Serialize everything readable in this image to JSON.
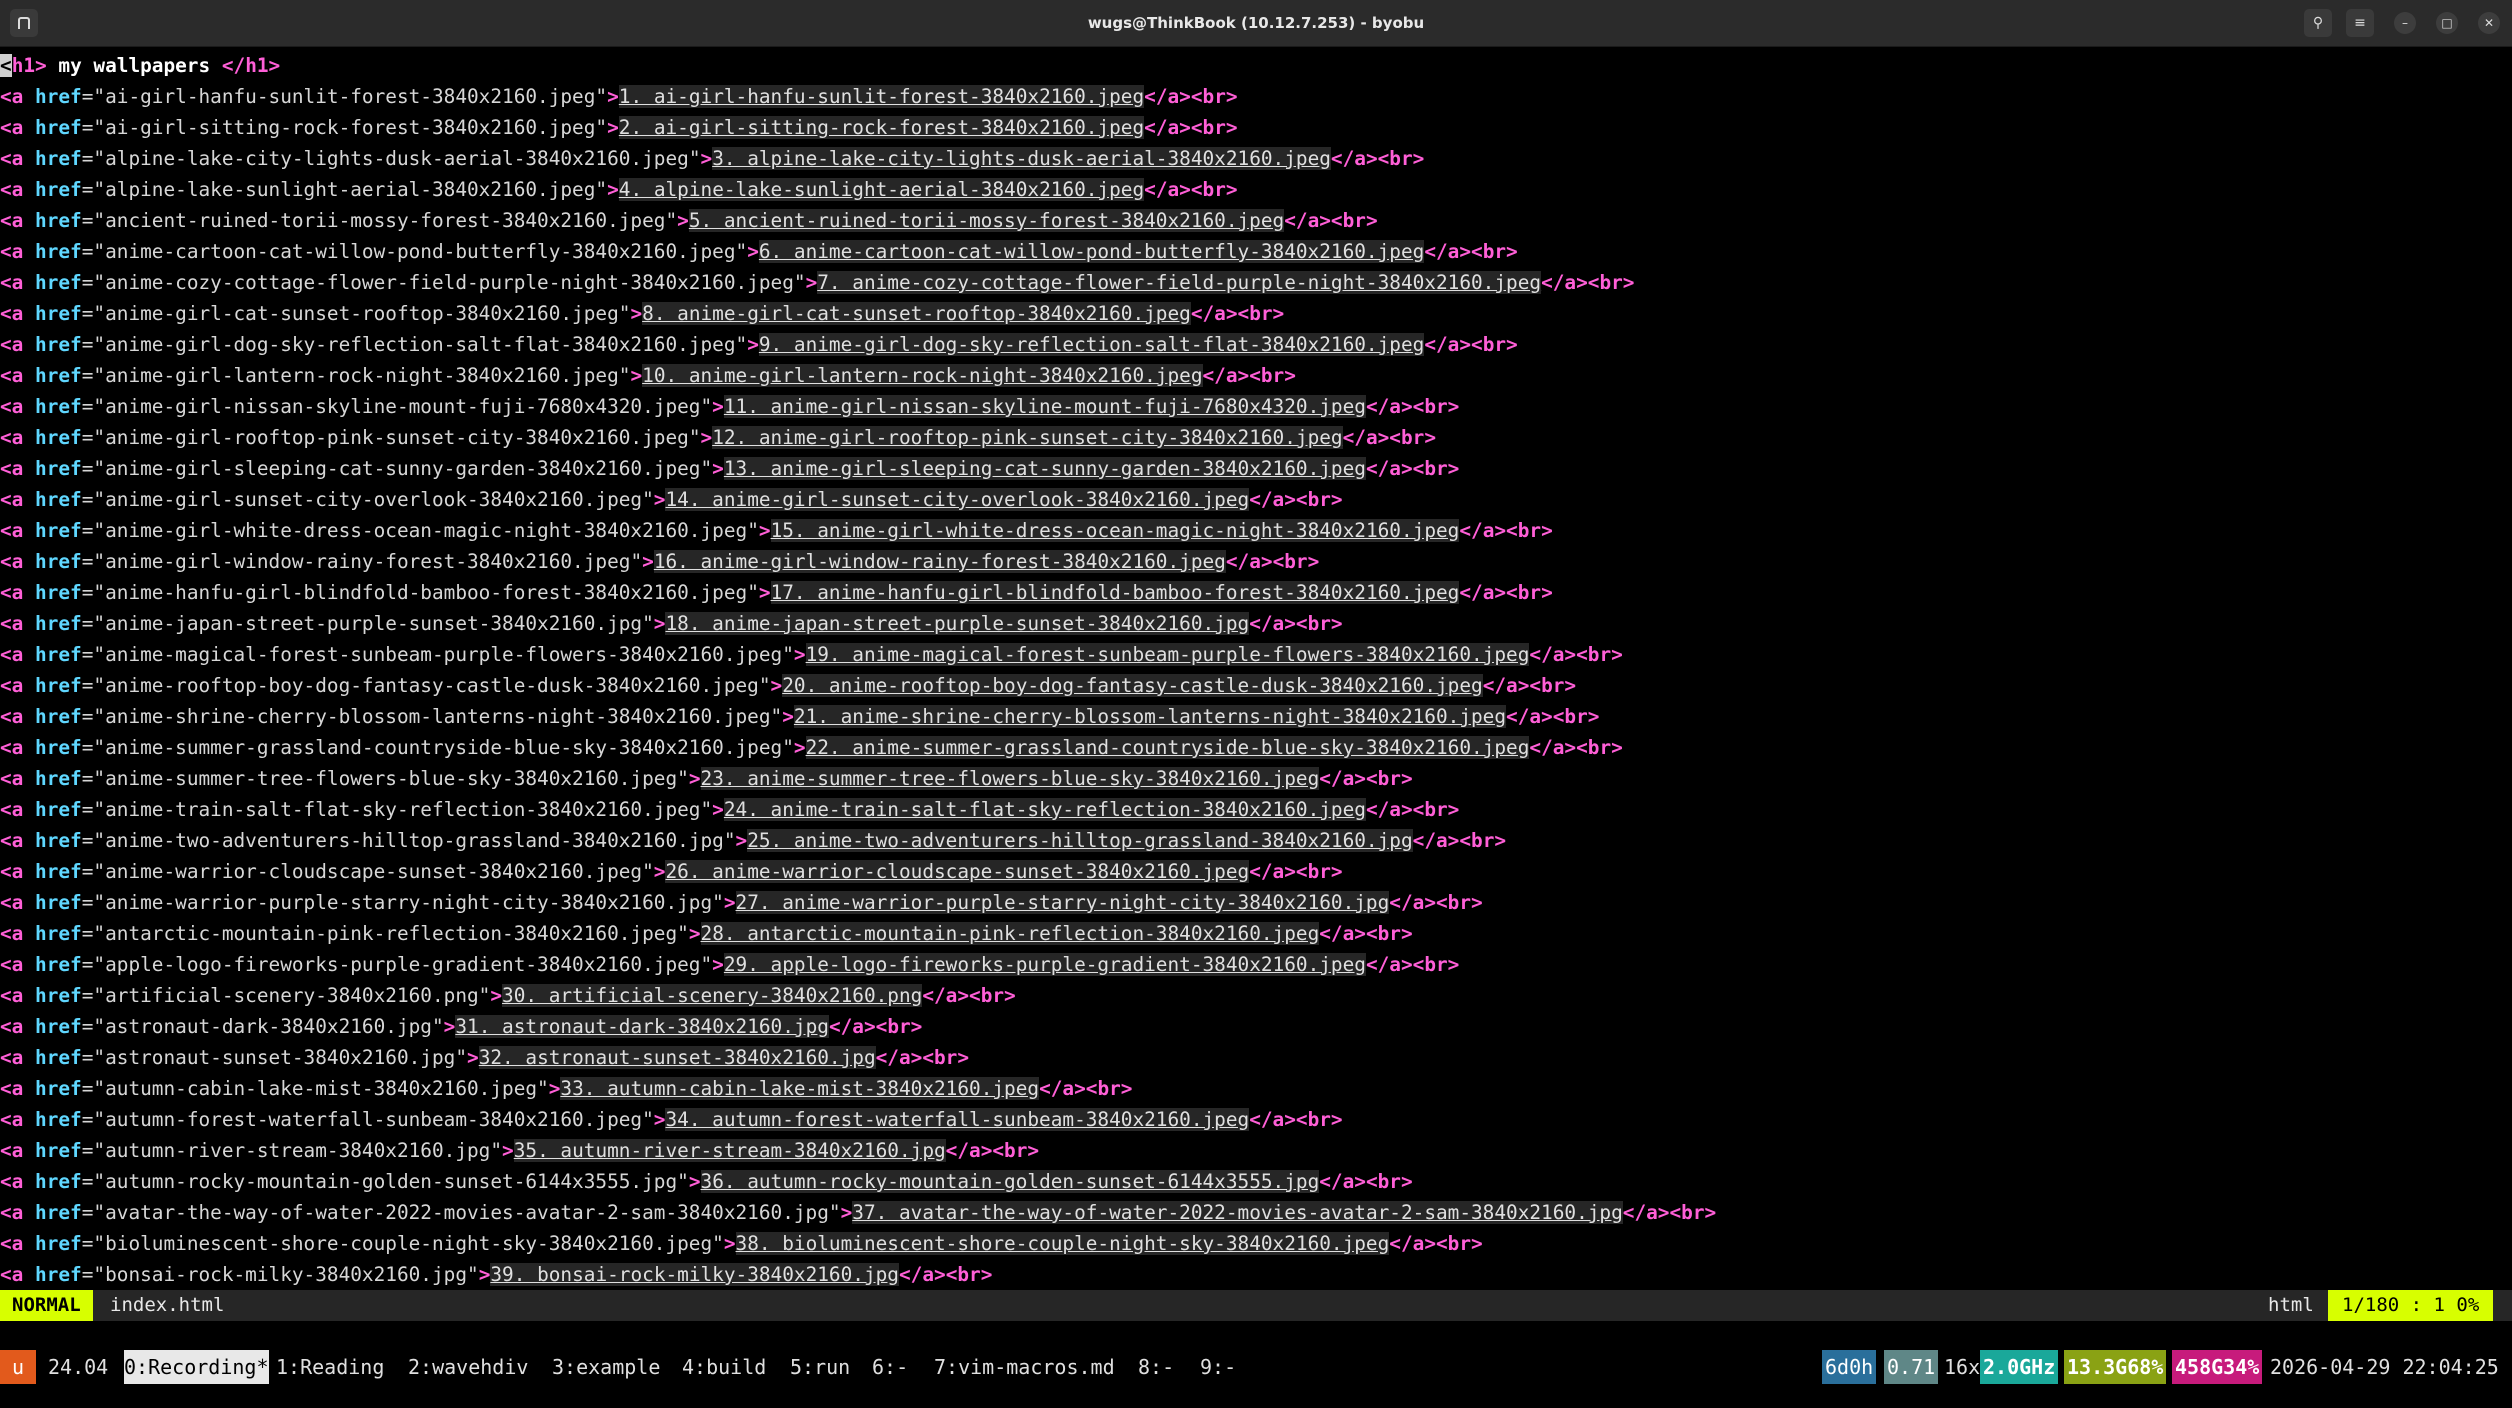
{
  "window": {
    "title": "wugs@ThinkBook (10.12.7.253) - byobu"
  },
  "editor": {
    "heading_open": "<h1>",
    "heading_text": " my wallpapers ",
    "heading_close": "</h1>",
    "lines": [
      {
        "href": "ai-girl-hanfu-sunlit-forest-3840x2160.jpeg",
        "text": "1. ai-girl-hanfu-sunlit-forest-3840x2160.jpeg"
      },
      {
        "href": "ai-girl-sitting-rock-forest-3840x2160.jpeg",
        "text": "2. ai-girl-sitting-rock-forest-3840x2160.jpeg"
      },
      {
        "href": "alpine-lake-city-lights-dusk-aerial-3840x2160.jpeg",
        "text": "3. alpine-lake-city-lights-dusk-aerial-3840x2160.jpeg"
      },
      {
        "href": "alpine-lake-sunlight-aerial-3840x2160.jpeg",
        "text": "4. alpine-lake-sunlight-aerial-3840x2160.jpeg"
      },
      {
        "href": "ancient-ruined-torii-mossy-forest-3840x2160.jpeg",
        "text": "5. ancient-ruined-torii-mossy-forest-3840x2160.jpeg"
      },
      {
        "href": "anime-cartoon-cat-willow-pond-butterfly-3840x2160.jpeg",
        "text": "6. anime-cartoon-cat-willow-pond-butterfly-3840x2160.jpeg"
      },
      {
        "href": "anime-cozy-cottage-flower-field-purple-night-3840x2160.jpeg",
        "text": "7. anime-cozy-cottage-flower-field-purple-night-3840x2160.jpeg"
      },
      {
        "href": "anime-girl-cat-sunset-rooftop-3840x2160.jpeg",
        "text": "8. anime-girl-cat-sunset-rooftop-3840x2160.jpeg"
      },
      {
        "href": "anime-girl-dog-sky-reflection-salt-flat-3840x2160.jpeg",
        "text": "9. anime-girl-dog-sky-reflection-salt-flat-3840x2160.jpeg"
      },
      {
        "href": "anime-girl-lantern-rock-night-3840x2160.jpeg",
        "text": "10. anime-girl-lantern-rock-night-3840x2160.jpeg"
      },
      {
        "href": "anime-girl-nissan-skyline-mount-fuji-7680x4320.jpeg",
        "text": "11. anime-girl-nissan-skyline-mount-fuji-7680x4320.jpeg"
      },
      {
        "href": "anime-girl-rooftop-pink-sunset-city-3840x2160.jpeg",
        "text": "12. anime-girl-rooftop-pink-sunset-city-3840x2160.jpeg"
      },
      {
        "href": "anime-girl-sleeping-cat-sunny-garden-3840x2160.jpeg",
        "text": "13. anime-girl-sleeping-cat-sunny-garden-3840x2160.jpeg"
      },
      {
        "href": "anime-girl-sunset-city-overlook-3840x2160.jpeg",
        "text": "14. anime-girl-sunset-city-overlook-3840x2160.jpeg"
      },
      {
        "href": "anime-girl-white-dress-ocean-magic-night-3840x2160.jpeg",
        "text": "15. anime-girl-white-dress-ocean-magic-night-3840x2160.jpeg"
      },
      {
        "href": "anime-girl-window-rainy-forest-3840x2160.jpeg",
        "text": "16. anime-girl-window-rainy-forest-3840x2160.jpeg"
      },
      {
        "href": "anime-hanfu-girl-blindfold-bamboo-forest-3840x2160.jpeg",
        "text": "17. anime-hanfu-girl-blindfold-bamboo-forest-3840x2160.jpeg"
      },
      {
        "href": "anime-japan-street-purple-sunset-3840x2160.jpg",
        "text": "18. anime-japan-street-purple-sunset-3840x2160.jpg"
      },
      {
        "href": "anime-magical-forest-sunbeam-purple-flowers-3840x2160.jpeg",
        "text": "19. anime-magical-forest-sunbeam-purple-flowers-3840x2160.jpeg"
      },
      {
        "href": "anime-rooftop-boy-dog-fantasy-castle-dusk-3840x2160.jpeg",
        "text": "20. anime-rooftop-boy-dog-fantasy-castle-dusk-3840x2160.jpeg"
      },
      {
        "href": "anime-shrine-cherry-blossom-lanterns-night-3840x2160.jpeg",
        "text": "21. anime-shrine-cherry-blossom-lanterns-night-3840x2160.jpeg"
      },
      {
        "href": "anime-summer-grassland-countryside-blue-sky-3840x2160.jpeg",
        "text": "22. anime-summer-grassland-countryside-blue-sky-3840x2160.jpeg"
      },
      {
        "href": "anime-summer-tree-flowers-blue-sky-3840x2160.jpeg",
        "text": "23. anime-summer-tree-flowers-blue-sky-3840x2160.jpeg"
      },
      {
        "href": "anime-train-salt-flat-sky-reflection-3840x2160.jpeg",
        "text": "24. anime-train-salt-flat-sky-reflection-3840x2160.jpeg"
      },
      {
        "href": "anime-two-adventurers-hilltop-grassland-3840x2160.jpg",
        "text": "25. anime-two-adventurers-hilltop-grassland-3840x2160.jpg"
      },
      {
        "href": "anime-warrior-cloudscape-sunset-3840x2160.jpeg",
        "text": "26. anime-warrior-cloudscape-sunset-3840x2160.jpeg"
      },
      {
        "href": "anime-warrior-purple-starry-night-city-3840x2160.jpg",
        "text": "27. anime-warrior-purple-starry-night-city-3840x2160.jpg"
      },
      {
        "href": "antarctic-mountain-pink-reflection-3840x2160.jpeg",
        "text": "28. antarctic-mountain-pink-reflection-3840x2160.jpeg"
      },
      {
        "href": "apple-logo-fireworks-purple-gradient-3840x2160.jpeg",
        "text": "29. apple-logo-fireworks-purple-gradient-3840x2160.jpeg"
      },
      {
        "href": "artificial-scenery-3840x2160.png",
        "text": "30. artificial-scenery-3840x2160.png"
      },
      {
        "href": "astronaut-dark-3840x2160.jpg",
        "text": "31. astronaut-dark-3840x2160.jpg"
      },
      {
        "href": "astronaut-sunset-3840x2160.jpg",
        "text": "32. astronaut-sunset-3840x2160.jpg"
      },
      {
        "href": "autumn-cabin-lake-mist-3840x2160.jpeg",
        "text": "33. autumn-cabin-lake-mist-3840x2160.jpeg"
      },
      {
        "href": "autumn-forest-waterfall-sunbeam-3840x2160.jpeg",
        "text": "34. autumn-forest-waterfall-sunbeam-3840x2160.jpeg"
      },
      {
        "href": "autumn-river-stream-3840x2160.jpg",
        "text": "35. autumn-river-stream-3840x2160.jpg"
      },
      {
        "href": "autumn-rocky-mountain-golden-sunset-6144x3555.jpg",
        "text": "36. autumn-rocky-mountain-golden-sunset-6144x3555.jpg"
      },
      {
        "href": "avatar-the-way-of-water-2022-movies-avatar-2-sam-3840x2160.jpg",
        "text": "37. avatar-the-way-of-water-2022-movies-avatar-2-sam-3840x2160.jpg"
      },
      {
        "href": "bioluminescent-shore-couple-night-sky-3840x2160.jpeg",
        "text": "38. bioluminescent-shore-couple-night-sky-3840x2160.jpeg"
      },
      {
        "href": "bonsai-rock-milky-3840x2160.jpg",
        "text": "39. bonsai-rock-milky-3840x2160.jpg"
      }
    ]
  },
  "statusline": {
    "mode": "NORMAL",
    "filename": "index.html",
    "filetype": "html",
    "position": "1/180 : 1 0%"
  },
  "byobu": {
    "logo": "u",
    "release": "24.04",
    "windows": [
      {
        "label": "0:Recording*",
        "active": true
      },
      {
        "label": "1:Reading",
        "active": false
      },
      {
        "label": "2:wavehdiv",
        "active": false
      },
      {
        "label": "3:example",
        "active": false
      },
      {
        "label": "4:build",
        "active": false
      },
      {
        "label": "5:run",
        "active": false
      },
      {
        "label": "6:-",
        "active": false
      },
      {
        "label": "7:vim-macros.md",
        "active": false
      },
      {
        "label": "8:-",
        "active": false
      },
      {
        "label": "9:-",
        "active": false
      }
    ],
    "uptime": "6d0h",
    "load": "0.71",
    "cpu_count": "16x",
    "cpu_freq": "2.0GHz",
    "mem_used": "13.3G",
    "mem_pct": "68%",
    "disk_used": "458G",
    "disk_pct": "34%",
    "datetime": "2026-04-29 22:04:25"
  },
  "colors": {
    "tag": "#ff5fd7",
    "attr": "#5fd7ff",
    "mode_bg": "#d7ff00",
    "byobu_logo": "#e25a1c",
    "uptime_bg": "#2a6f9b",
    "load_bg": "#5f8787",
    "freq_bg": "#1aa89a",
    "mem_bg": "#8aa214",
    "disk_bg": "#c71b7c"
  }
}
